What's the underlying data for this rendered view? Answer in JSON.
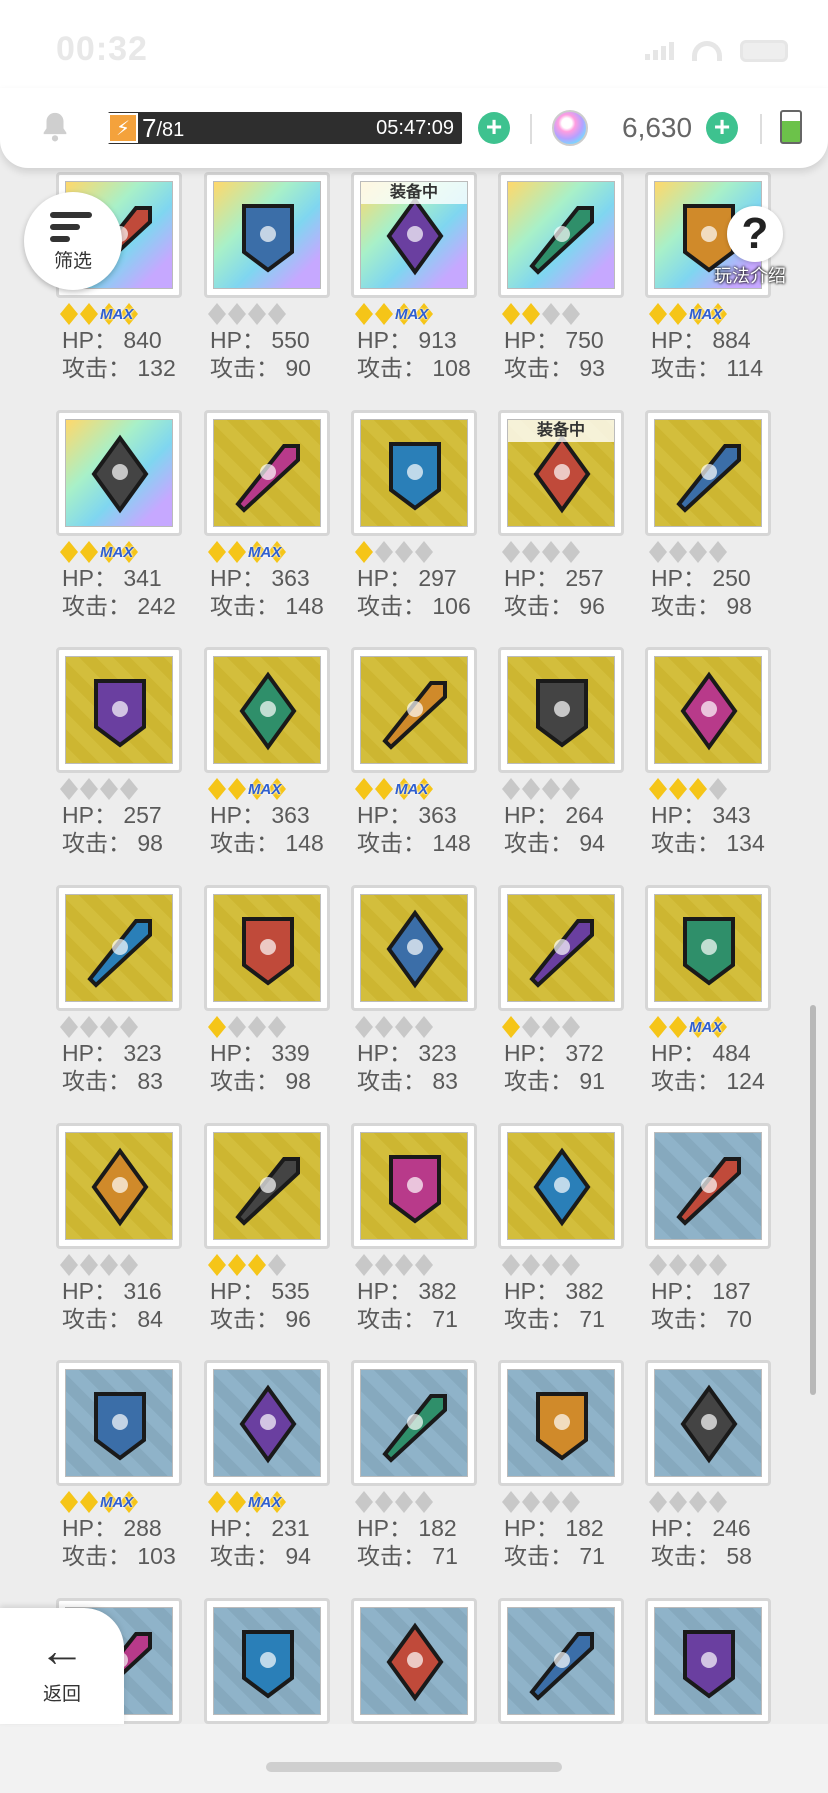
{
  "status": {
    "time": "00:32"
  },
  "resources": {
    "energy_current": "7",
    "energy_max": "/81",
    "energy_timer": "05:47:09",
    "gems": "6,630"
  },
  "buttons": {
    "filter_label": "筛选",
    "help_label": "玩法介绍",
    "back_label": "返回",
    "equipped_label": "装备中"
  },
  "labels": {
    "hp": "HP：",
    "atk": "攻击：",
    "max": "MAX"
  },
  "items": [
    {
      "hp": "840",
      "atk": "132",
      "stars": 2,
      "max": true,
      "bg": "rainbow",
      "icon": "shield-crest-icon",
      "equipped": false
    },
    {
      "hp": "550",
      "atk": "90",
      "stars": 0,
      "max": false,
      "bg": "rainbow",
      "icon": "shield-icon",
      "equipped": false
    },
    {
      "hp": "913",
      "atk": "108",
      "stars": 2,
      "max": true,
      "bg": "rainbow",
      "icon": "potion-necklace-icon",
      "equipped": true
    },
    {
      "hp": "750",
      "atk": "93",
      "stars": 2,
      "max": false,
      "bg": "rainbow",
      "icon": "memory-card-icon",
      "equipped": false
    },
    {
      "hp": "884",
      "atk": "114",
      "stars": 2,
      "max": true,
      "bg": "rainbow",
      "icon": "gem-necklace-icon",
      "equipped": false
    },
    {
      "hp": "341",
      "atk": "242",
      "stars": 2,
      "max": true,
      "bg": "rainbow",
      "icon": "crossbow-icon",
      "equipped": false
    },
    {
      "hp": "363",
      "atk": "148",
      "stars": 2,
      "max": true,
      "bg": "gold",
      "icon": "ice-sword-icon",
      "equipped": false
    },
    {
      "hp": "297",
      "atk": "106",
      "stars": 1,
      "max": false,
      "bg": "gold",
      "icon": "dark-sword-icon",
      "equipped": false
    },
    {
      "hp": "257",
      "atk": "96",
      "stars": 0,
      "max": false,
      "bg": "gold",
      "icon": "curved-blade-icon",
      "equipped": true
    },
    {
      "hp": "250",
      "atk": "98",
      "stars": 0,
      "max": false,
      "bg": "gold",
      "icon": "fire-sword-icon",
      "equipped": false
    },
    {
      "hp": "257",
      "atk": "98",
      "stars": 0,
      "max": false,
      "bg": "gold",
      "icon": "crystal-dagger-icon",
      "equipped": false
    },
    {
      "hp": "363",
      "atk": "148",
      "stars": 2,
      "max": true,
      "bg": "gold",
      "icon": "war-axe-icon",
      "equipped": false
    },
    {
      "hp": "363",
      "atk": "148",
      "stars": 2,
      "max": true,
      "bg": "gold",
      "icon": "scythe-axe-icon",
      "equipped": false
    },
    {
      "hp": "264",
      "atk": "94",
      "stars": 0,
      "max": false,
      "bg": "gold",
      "icon": "spear-icon",
      "equipped": false
    },
    {
      "hp": "343",
      "atk": "134",
      "stars": 3,
      "max": false,
      "bg": "gold",
      "icon": "star-staff-icon",
      "equipped": false
    },
    {
      "hp": "323",
      "atk": "83",
      "stars": 0,
      "max": false,
      "bg": "gold",
      "icon": "bow-icon",
      "equipped": false
    },
    {
      "hp": "339",
      "atk": "98",
      "stars": 1,
      "max": false,
      "bg": "gold",
      "icon": "spell-book-icon",
      "equipped": false
    },
    {
      "hp": "323",
      "atk": "83",
      "stars": 0,
      "max": false,
      "bg": "gold",
      "icon": "pickaxe-icon",
      "equipped": false
    },
    {
      "hp": "372",
      "atk": "91",
      "stars": 1,
      "max": false,
      "bg": "gold",
      "icon": "gauntlet-icon",
      "equipped": false
    },
    {
      "hp": "484",
      "atk": "124",
      "stars": 2,
      "max": true,
      "bg": "gold",
      "icon": "helmet-icon",
      "equipped": false
    },
    {
      "hp": "316",
      "atk": "84",
      "stars": 0,
      "max": false,
      "bg": "gold",
      "icon": "dark-orb-shield-icon",
      "equipped": false
    },
    {
      "hp": "535",
      "atk": "96",
      "stars": 3,
      "max": false,
      "bg": "gold",
      "icon": "angel-wings-icon",
      "equipped": false
    },
    {
      "hp": "382",
      "atk": "71",
      "stars": 0,
      "max": false,
      "bg": "gold",
      "icon": "sun-medallion-icon",
      "equipped": false
    },
    {
      "hp": "382",
      "atk": "71",
      "stars": 0,
      "max": false,
      "bg": "gold",
      "icon": "computer-icon",
      "equipped": false
    },
    {
      "hp": "187",
      "atk": "70",
      "stars": 0,
      "max": false,
      "bg": "blue",
      "icon": "blue-dagger-icon",
      "equipped": false
    },
    {
      "hp": "288",
      "atk": "103",
      "stars": 2,
      "max": true,
      "bg": "blue",
      "icon": "knife-icon",
      "equipped": false
    },
    {
      "hp": "231",
      "atk": "94",
      "stars": 2,
      "max": true,
      "bg": "blue",
      "icon": "battle-axe-icon",
      "equipped": false
    },
    {
      "hp": "182",
      "atk": "71",
      "stars": 0,
      "max": false,
      "bg": "blue",
      "icon": "hatchet-icon",
      "equipped": false
    },
    {
      "hp": "182",
      "atk": "71",
      "stars": 0,
      "max": false,
      "bg": "blue",
      "icon": "sickle-icon",
      "equipped": false
    },
    {
      "hp": "246",
      "atk": "58",
      "stars": 0,
      "max": false,
      "bg": "blue",
      "icon": "crossbow-wood-icon",
      "equipped": false
    },
    {
      "hp": "",
      "atk": "",
      "stars": 0,
      "max": false,
      "bg": "blue",
      "icon": "scroll-icon",
      "equipped": false,
      "partial": true
    },
    {
      "hp": "",
      "atk": "",
      "stars": 0,
      "max": false,
      "bg": "blue",
      "icon": "green-wand-icon",
      "equipped": false,
      "partial": true
    },
    {
      "hp": "",
      "atk": "",
      "stars": 0,
      "max": false,
      "bg": "blue",
      "icon": "blue-staff-icon",
      "equipped": false,
      "partial": true
    },
    {
      "hp": "",
      "atk": "",
      "stars": 0,
      "max": false,
      "bg": "blue",
      "icon": "ruby-scepter-icon",
      "equipped": false,
      "partial": true
    },
    {
      "hp": "",
      "atk": "",
      "stars": 0,
      "max": false,
      "bg": "blue",
      "icon": "turtle-shell-icon",
      "equipped": false,
      "partial": true
    }
  ],
  "colors": {
    "accent_green": "#3ec28f",
    "star_gold": "#f5c518",
    "star_grey": "#c8c8c8",
    "max_blue": "#2f5fd0"
  }
}
